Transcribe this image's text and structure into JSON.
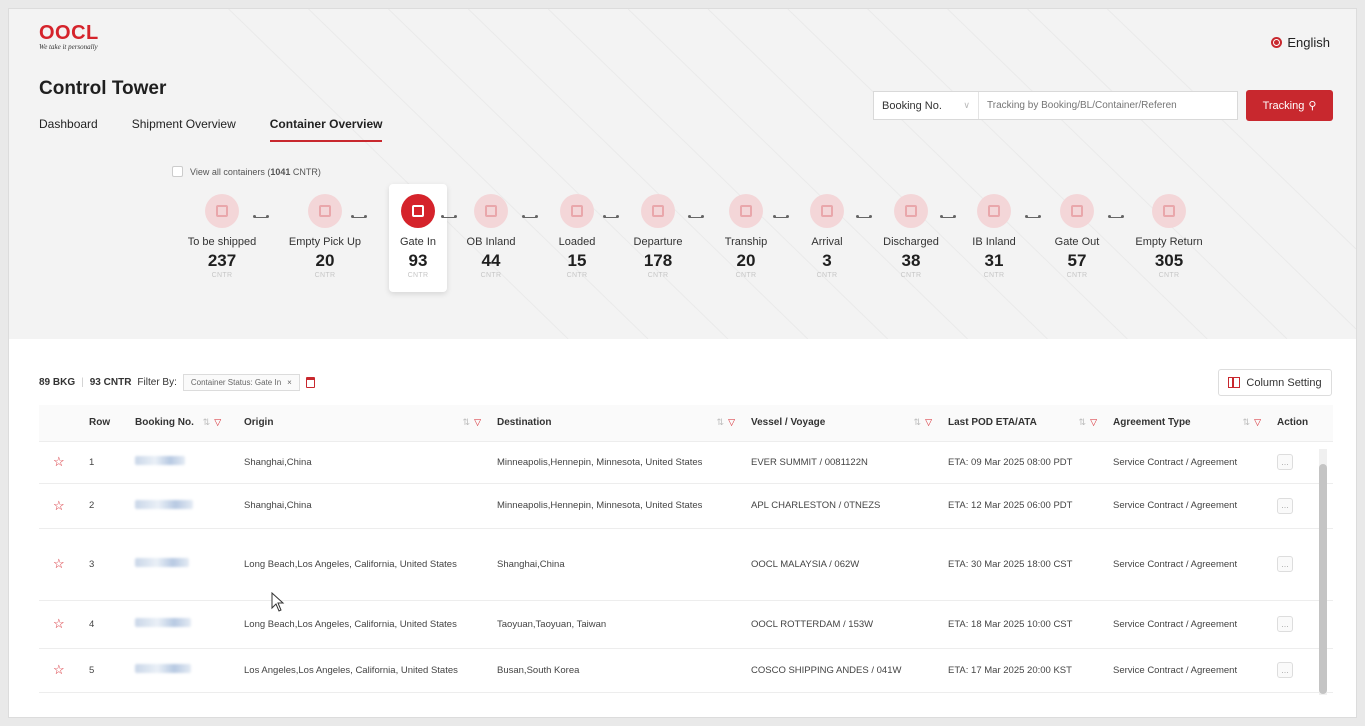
{
  "brand": {
    "logo": "OOCL",
    "tagline": "We take it personally"
  },
  "language": "English",
  "page_title": "Control Tower",
  "tabs": [
    {
      "label": "Dashboard",
      "active": false
    },
    {
      "label": "Shipment Overview",
      "active": false
    },
    {
      "label": "Container Overview",
      "active": true
    }
  ],
  "search": {
    "type_selected": "Booking No.",
    "placeholder": "Tracking by Booking/BL/Container/Referen",
    "button_label": "Tracking"
  },
  "view_all": {
    "label_prefix": "View all containers (",
    "count": "1041",
    "label_suffix": " CNTR)"
  },
  "statuses": [
    {
      "label": "To be shipped",
      "count": "237",
      "unit": "CNTR",
      "icon": "warehouse-icon",
      "active": false
    },
    {
      "label": "Empty Pick Up",
      "count": "20",
      "unit": "CNTR",
      "icon": "empty-container-icon",
      "active": false
    },
    {
      "label": "Gate In",
      "count": "93",
      "unit": "CNTR",
      "icon": "gate-in-icon",
      "active": true
    },
    {
      "label": "OB Inland",
      "count": "44",
      "unit": "CNTR",
      "icon": "truck-icon",
      "active": false
    },
    {
      "label": "Loaded",
      "count": "15",
      "unit": "CNTR",
      "icon": "crane-load-icon",
      "active": false
    },
    {
      "label": "Departure",
      "count": "178",
      "unit": "CNTR",
      "icon": "ship-departure-icon",
      "active": false
    },
    {
      "label": "Tranship",
      "count": "20",
      "unit": "CNTR",
      "icon": "tranship-icon",
      "active": false
    },
    {
      "label": "Arrival",
      "count": "3",
      "unit": "CNTR",
      "icon": "ship-arrival-icon",
      "active": false
    },
    {
      "label": "Discharged",
      "count": "38",
      "unit": "CNTR",
      "icon": "crane-discharge-icon",
      "active": false
    },
    {
      "label": "IB Inland",
      "count": "31",
      "unit": "CNTR",
      "icon": "truck-icon",
      "active": false
    },
    {
      "label": "Gate Out",
      "count": "57",
      "unit": "CNTR",
      "icon": "gate-out-icon",
      "active": false
    },
    {
      "label": "Empty Return",
      "count": "305",
      "unit": "CNTR",
      "icon": "empty-return-icon",
      "active": false
    }
  ],
  "filter": {
    "bkg": "89 BKG",
    "cntr": "93 CNTR",
    "filter_by": "Filter By:",
    "chip": "Container Status: Gate In",
    "chip_close": "×"
  },
  "column_setting": "Column Setting",
  "table": {
    "headers": [
      "Row",
      "Booking No.",
      "Origin",
      "Destination",
      "Vessel / Voyage",
      "Last POD ETA/ATA",
      "Agreement Type",
      "Action"
    ],
    "rows": [
      {
        "row": "1",
        "origin": "Shanghai,China",
        "destination": "Minneapolis,Hennepin, Minnesota, United States",
        "vessel": "EVER SUMMIT / 0081122N",
        "eta": "ETA: 09 Mar 2025 08:00 PDT",
        "agreement": "Service Contract / Agreement"
      },
      {
        "row": "2",
        "origin": "Shanghai,China",
        "destination": "Minneapolis,Hennepin, Minnesota, United States",
        "vessel": "APL CHARLESTON / 0TNEZS",
        "eta": "ETA: 12 Mar 2025 06:00 PDT",
        "agreement": "Service Contract / Agreement"
      },
      {
        "row": "3",
        "origin": "Long Beach,Los Angeles, California, United States",
        "destination": "Shanghai,China",
        "vessel": "OOCL MALAYSIA / 062W",
        "eta": "ETA: 30 Mar 2025 18:00 CST",
        "agreement": "Service Contract / Agreement"
      },
      {
        "row": "4",
        "origin": "Long Beach,Los Angeles, California, United States",
        "destination": "Taoyuan,Taoyuan, Taiwan",
        "vessel": "OOCL ROTTERDAM / 153W",
        "eta": "ETA: 18 Mar 2025 10:00 CST",
        "agreement": "Service Contract / Agreement"
      },
      {
        "row": "5",
        "origin": "Los Angeles,Los Angeles, California, United States",
        "destination": "Busan,South Korea",
        "vessel": "COSCO SHIPPING ANDES / 041W",
        "eta": "ETA: 17 Mar 2025 20:00 KST",
        "agreement": "Service Contract / Agreement"
      }
    ]
  },
  "colors": {
    "brand_red": "#d5232b",
    "step_inactive": "#f3d6d8"
  }
}
